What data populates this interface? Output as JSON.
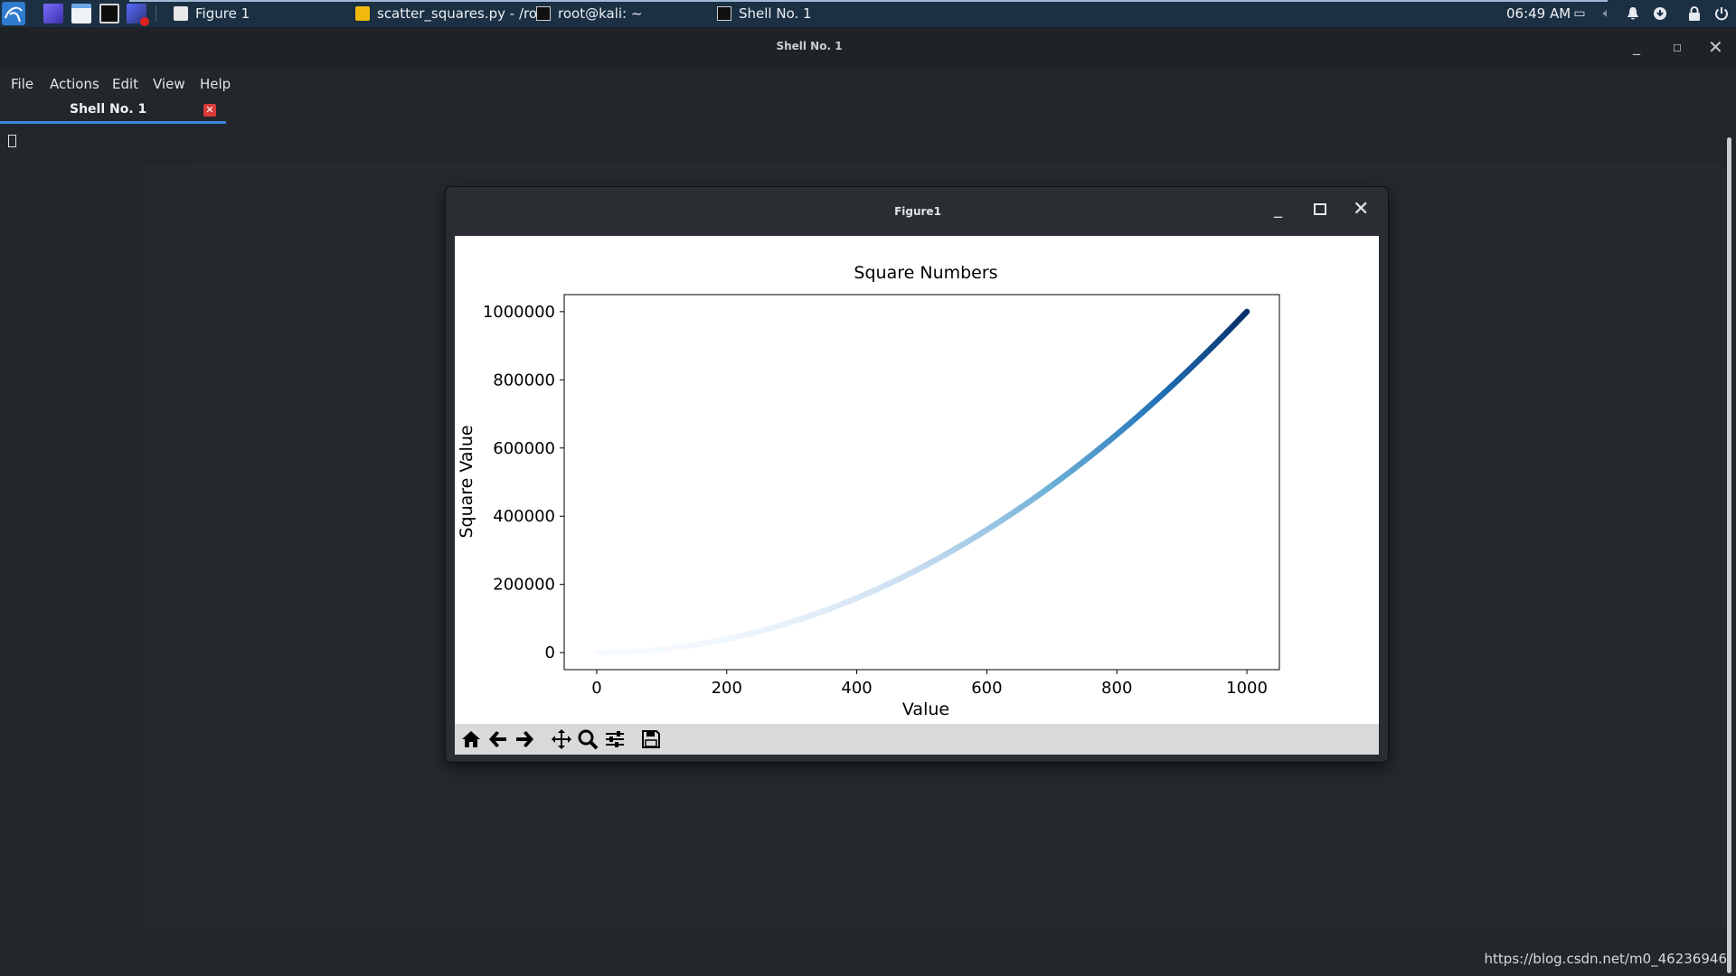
{
  "taskbar": {
    "tasks": [
      {
        "label": "Figure 1"
      },
      {
        "label": "scatter_squares.py - /ro..."
      },
      {
        "label": "root@kali: ~"
      },
      {
        "label": "Shell No. 1"
      }
    ],
    "clock": "06:49 AM"
  },
  "terminal": {
    "title": "Shell No. 1",
    "menu": {
      "file": "File",
      "actions": "Actions",
      "edit": "Edit",
      "view": "View",
      "help": "Help"
    },
    "tab_label": "Shell No. 1"
  },
  "figure": {
    "window_title": "Figure1"
  },
  "chart_data": {
    "type": "scatter",
    "title": "Square Numbers",
    "xlabel": "Value",
    "ylabel": "Square Value",
    "x_range": [
      1,
      1000
    ],
    "formula": "y = x^2",
    "colormap": "Blues",
    "xlim": [
      -50,
      1050
    ],
    "ylim": [
      -50000,
      1050000
    ],
    "xticks": [
      0,
      200,
      400,
      600,
      800,
      1000
    ],
    "yticks": [
      0,
      200000,
      400000,
      600000,
      800000,
      1000000
    ],
    "xtick_labels": [
      "0",
      "200",
      "400",
      "600",
      "800",
      "1000"
    ],
    "ytick_labels": [
      "0",
      "200000",
      "400000",
      "600000",
      "800000",
      "1000000"
    ],
    "grid": false,
    "legend": "none"
  },
  "watermark": "https://blog.csdn.net/m0_46236946"
}
